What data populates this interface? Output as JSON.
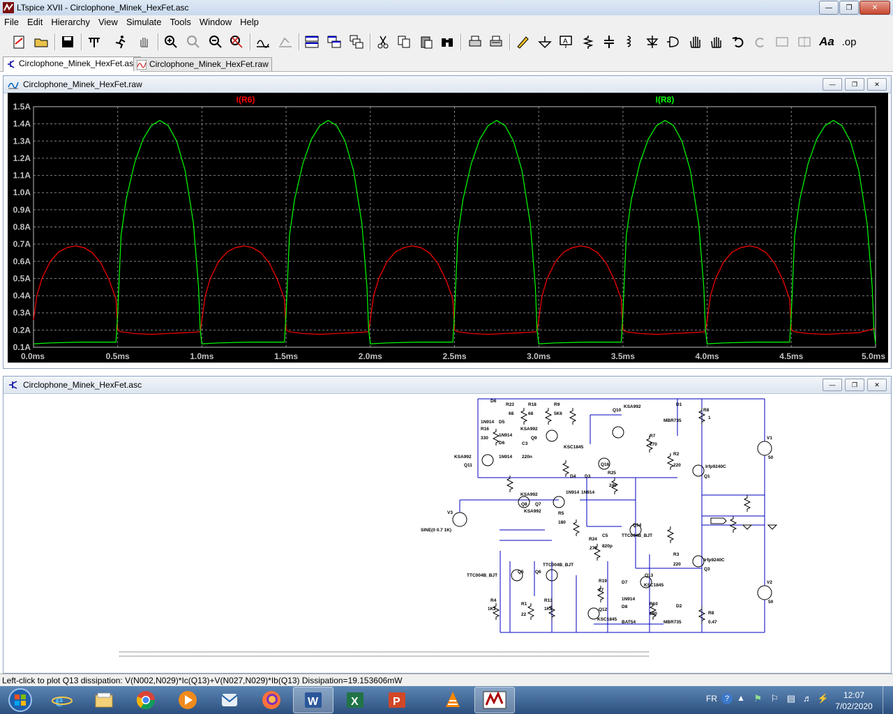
{
  "window": {
    "title": "LTspice XVII - Circlophone_Minek_HexFet.asc"
  },
  "menu": [
    "File",
    "Edit",
    "Hierarchy",
    "View",
    "Simulate",
    "Tools",
    "Window",
    "Help"
  ],
  "toolbar": {
    "icons": [
      "new-schematic",
      "open",
      "save",
      "control-panel",
      "run",
      "halt",
      "zoom-in",
      "pan",
      "zoom-out",
      "zoom-fit",
      "autoscale",
      "tile-vertical",
      "tile-horizontal",
      "cascade",
      "close-window",
      "cut",
      "copy",
      "paste",
      "find",
      "print",
      "print-setup",
      "draw-wire",
      "ground",
      "label-net",
      "resistor",
      "capacitor",
      "inductor",
      "diode",
      "component",
      "move",
      "drag",
      "undo",
      "redo",
      "rotate",
      "mirror",
      "text",
      "spice-directive"
    ],
    "text_aa": "Aa",
    "text_op": ".op"
  },
  "tabs": [
    {
      "label": "Circlophone_Minek_HexFet.asc",
      "active": true
    },
    {
      "label": "Circlophone_Minek_HexFet.raw",
      "active": false
    }
  ],
  "waveform_window": {
    "title": "Circlophone_Minek_HexFet.raw"
  },
  "chart_data": {
    "type": "line",
    "title": "",
    "xlabel": "",
    "ylabel": "",
    "xlim": [
      0,
      5.0
    ],
    "ylim": [
      0.1,
      1.5
    ],
    "grid": true,
    "legend_placement": "top",
    "x_ticks": [
      "0.0ms",
      "0.5ms",
      "1.0ms",
      "1.5ms",
      "2.0ms",
      "2.5ms",
      "3.0ms",
      "3.5ms",
      "4.0ms",
      "4.5ms",
      "5.0ms"
    ],
    "y_ticks": [
      "0.1A",
      "0.2A",
      "0.3A",
      "0.4A",
      "0.5A",
      "0.6A",
      "0.7A",
      "0.8A",
      "0.9A",
      "1.0A",
      "1.1A",
      "1.2A",
      "1.3A",
      "1.4A",
      "1.5A"
    ],
    "series": [
      {
        "name": "I(R6)",
        "color": "#ff0000",
        "x": [
          0.0,
          0.02,
          0.05,
          0.1,
          0.15,
          0.2,
          0.25,
          0.3,
          0.35,
          0.4,
          0.45,
          0.49,
          0.5,
          0.52,
          0.6,
          0.7,
          0.8,
          0.9,
          0.99,
          1.0,
          1.02,
          1.05,
          1.1,
          1.15,
          1.2,
          1.25,
          1.3,
          1.35,
          1.4,
          1.45,
          1.49,
          1.5,
          1.52,
          1.6,
          1.7,
          1.8,
          1.9,
          1.99,
          2.0,
          2.02,
          2.05,
          2.1,
          2.15,
          2.2,
          2.25,
          2.3,
          2.35,
          2.4,
          2.45,
          2.49,
          2.5,
          2.52,
          2.6,
          2.7,
          2.8,
          2.9,
          2.99,
          3.0,
          3.02,
          3.05,
          3.1,
          3.15,
          3.2,
          3.25,
          3.3,
          3.35,
          3.4,
          3.45,
          3.49,
          3.5,
          3.52,
          3.6,
          3.7,
          3.8,
          3.9,
          3.99,
          4.0,
          4.02,
          4.05,
          4.1,
          4.15,
          4.2,
          4.25,
          4.3,
          4.35,
          4.4,
          4.45,
          4.49,
          4.5,
          4.52,
          4.6,
          4.7,
          4.8,
          4.9,
          5.0
        ],
        "values": [
          0.26,
          0.4,
          0.5,
          0.6,
          0.655,
          0.68,
          0.69,
          0.68,
          0.65,
          0.59,
          0.49,
          0.38,
          0.2,
          0.19,
          0.18,
          0.175,
          0.18,
          0.185,
          0.19,
          0.26,
          0.4,
          0.5,
          0.6,
          0.655,
          0.68,
          0.69,
          0.68,
          0.65,
          0.59,
          0.49,
          0.38,
          0.2,
          0.19,
          0.18,
          0.175,
          0.18,
          0.185,
          0.19,
          0.26,
          0.4,
          0.5,
          0.6,
          0.655,
          0.68,
          0.69,
          0.68,
          0.65,
          0.59,
          0.49,
          0.38,
          0.2,
          0.19,
          0.18,
          0.175,
          0.18,
          0.185,
          0.19,
          0.26,
          0.4,
          0.5,
          0.6,
          0.655,
          0.68,
          0.69,
          0.68,
          0.65,
          0.59,
          0.49,
          0.38,
          0.2,
          0.19,
          0.18,
          0.175,
          0.18,
          0.185,
          0.19,
          0.26,
          0.4,
          0.5,
          0.6,
          0.655,
          0.68,
          0.69,
          0.68,
          0.65,
          0.59,
          0.49,
          0.38,
          0.2,
          0.19,
          0.18,
          0.175,
          0.18,
          0.185,
          0.21
        ]
      },
      {
        "name": "I(R8)",
        "color": "#00ff00",
        "x": [
          0.0,
          0.1,
          0.2,
          0.3,
          0.4,
          0.49,
          0.5,
          0.52,
          0.55,
          0.6,
          0.65,
          0.7,
          0.75,
          0.8,
          0.85,
          0.9,
          0.95,
          0.98,
          0.99,
          1.0,
          1.1,
          1.2,
          1.3,
          1.4,
          1.49,
          1.5,
          1.52,
          1.55,
          1.6,
          1.65,
          1.7,
          1.75,
          1.8,
          1.85,
          1.9,
          1.95,
          1.98,
          1.99,
          2.0,
          2.1,
          2.2,
          2.3,
          2.4,
          2.49,
          2.5,
          2.52,
          2.55,
          2.6,
          2.65,
          2.7,
          2.75,
          2.8,
          2.85,
          2.9,
          2.95,
          2.98,
          2.99,
          3.0,
          3.1,
          3.2,
          3.3,
          3.4,
          3.49,
          3.5,
          3.52,
          3.55,
          3.6,
          3.65,
          3.7,
          3.75,
          3.8,
          3.85,
          3.9,
          3.95,
          3.98,
          3.99,
          4.0,
          4.1,
          4.2,
          4.3,
          4.4,
          4.49,
          4.5,
          4.52,
          4.55,
          4.6,
          4.65,
          4.7,
          4.75,
          4.8,
          4.85,
          4.9,
          4.95,
          4.98,
          4.99,
          5.0
        ],
        "values": [
          0.12,
          0.125,
          0.128,
          0.13,
          0.13,
          0.13,
          0.3,
          0.75,
          0.96,
          1.17,
          1.31,
          1.39,
          1.42,
          1.39,
          1.3,
          1.13,
          0.82,
          0.45,
          0.2,
          0.12,
          0.125,
          0.128,
          0.13,
          0.13,
          0.13,
          0.3,
          0.75,
          0.96,
          1.17,
          1.31,
          1.39,
          1.42,
          1.39,
          1.3,
          1.13,
          0.82,
          0.45,
          0.2,
          0.12,
          0.125,
          0.128,
          0.13,
          0.13,
          0.13,
          0.3,
          0.75,
          0.96,
          1.17,
          1.31,
          1.39,
          1.42,
          1.39,
          1.3,
          1.13,
          0.82,
          0.45,
          0.2,
          0.12,
          0.125,
          0.128,
          0.13,
          0.13,
          0.13,
          0.3,
          0.75,
          0.96,
          1.17,
          1.31,
          1.39,
          1.42,
          1.39,
          1.3,
          1.13,
          0.82,
          0.45,
          0.2,
          0.12,
          0.125,
          0.128,
          0.13,
          0.13,
          0.13,
          0.3,
          0.75,
          0.96,
          1.17,
          1.31,
          1.39,
          1.42,
          1.39,
          1.3,
          1.13,
          0.82,
          0.45,
          0.2,
          0.12
        ]
      }
    ]
  },
  "schematic_window": {
    "title": "Circlophone_Minek_HexFet.asc"
  },
  "schematic": {
    "labels": [
      {
        "t": "D6"
      },
      {
        "t": "R23"
      },
      {
        "t": "R18"
      },
      {
        "t": "R9"
      },
      {
        "t": "Q10"
      },
      {
        "t": "KSA992"
      },
      {
        "t": "D1"
      },
      {
        "t": "R8"
      },
      {
        "t": "68"
      },
      {
        "t": "68"
      },
      {
        "t": "5K6"
      },
      {
        "t": "1"
      },
      {
        "t": "MBR735"
      },
      {
        "t": "1N914"
      },
      {
        "t": "D5"
      },
      {
        "t": "R16"
      },
      {
        "t": "1N914"
      },
      {
        "t": "330"
      },
      {
        "t": "KSA992"
      },
      {
        "t": "Q9"
      },
      {
        "t": "KSC1845"
      },
      {
        "t": "R7"
      },
      {
        "t": "270"
      },
      {
        "t": "D6"
      },
      {
        "t": "C3"
      },
      {
        "t": "220n"
      },
      {
        "t": "1N914"
      },
      {
        "t": "V1"
      },
      {
        "t": "50"
      },
      {
        "t": "KSA992"
      },
      {
        "t": "Q11"
      },
      {
        "t": "R2"
      },
      {
        "t": "220"
      },
      {
        "t": "Irfp9240C"
      },
      {
        "t": "Q16"
      },
      {
        "t": "R25"
      },
      {
        "t": "D4"
      },
      {
        "t": "D3"
      },
      {
        "t": "1N914"
      },
      {
        "t": "1N914"
      },
      {
        "t": "240"
      },
      {
        "t": "Q1"
      },
      {
        "t": "KSA992"
      },
      {
        "t": "Q8"
      },
      {
        "t": "Q7"
      },
      {
        "t": "KSA992"
      },
      {
        "t": "R5"
      },
      {
        "t": "180"
      },
      {
        "t": "V3"
      },
      {
        "t": "SINE(0 0.7 1K)"
      },
      {
        "t": "Q14"
      },
      {
        "t": "out"
      },
      {
        "t": "C5"
      },
      {
        "t": "R24"
      },
      {
        "t": "270"
      },
      {
        "t": "820p"
      },
      {
        "t": "TTC004B_BJT"
      },
      {
        "t": "R3"
      },
      {
        "t": "220"
      },
      {
        "t": "Irfp9240C"
      },
      {
        "t": "Q3"
      },
      {
        "t": "TTC004B_BJT"
      },
      {
        "t": "TTC004B_BJT"
      },
      {
        "t": "Q5"
      },
      {
        "t": "Q6"
      },
      {
        "t": "R19"
      },
      {
        "t": "27"
      },
      {
        "t": "D7"
      },
      {
        "t": "Q13"
      },
      {
        "t": "KSC1845"
      },
      {
        "t": "V2"
      },
      {
        "t": "50"
      },
      {
        "t": "1N914"
      },
      {
        "t": "R4"
      },
      {
        "t": "R1"
      },
      {
        "t": "R13"
      },
      {
        "t": "D8"
      },
      {
        "t": "R10"
      },
      {
        "t": "1K2"
      },
      {
        "t": "22"
      },
      {
        "t": "1K2"
      },
      {
        "t": "Q12"
      },
      {
        "t": "D2"
      },
      {
        "t": "R8"
      },
      {
        "t": "KSC1845"
      },
      {
        "t": "BAT54"
      },
      {
        "t": "680"
      },
      {
        "t": "MBR735"
      },
      {
        "t": "0.47"
      }
    ]
  },
  "status": {
    "text": "Left-click to plot Q13 dissipation: V(N002,N029)*Ic(Q13)+V(N027,N029)*Ib(Q13)   Dissipation=19.153606mW"
  },
  "taskbar": {
    "apps": [
      "start-orb",
      "internet-explorer",
      "file-explorer",
      "chrome",
      "media-player",
      "outlook",
      "firefox",
      "word",
      "excel",
      "powerpoint",
      "vlc",
      "ltspice"
    ],
    "lang": "FR",
    "time": "12:07",
    "date": "7/02/2020"
  }
}
